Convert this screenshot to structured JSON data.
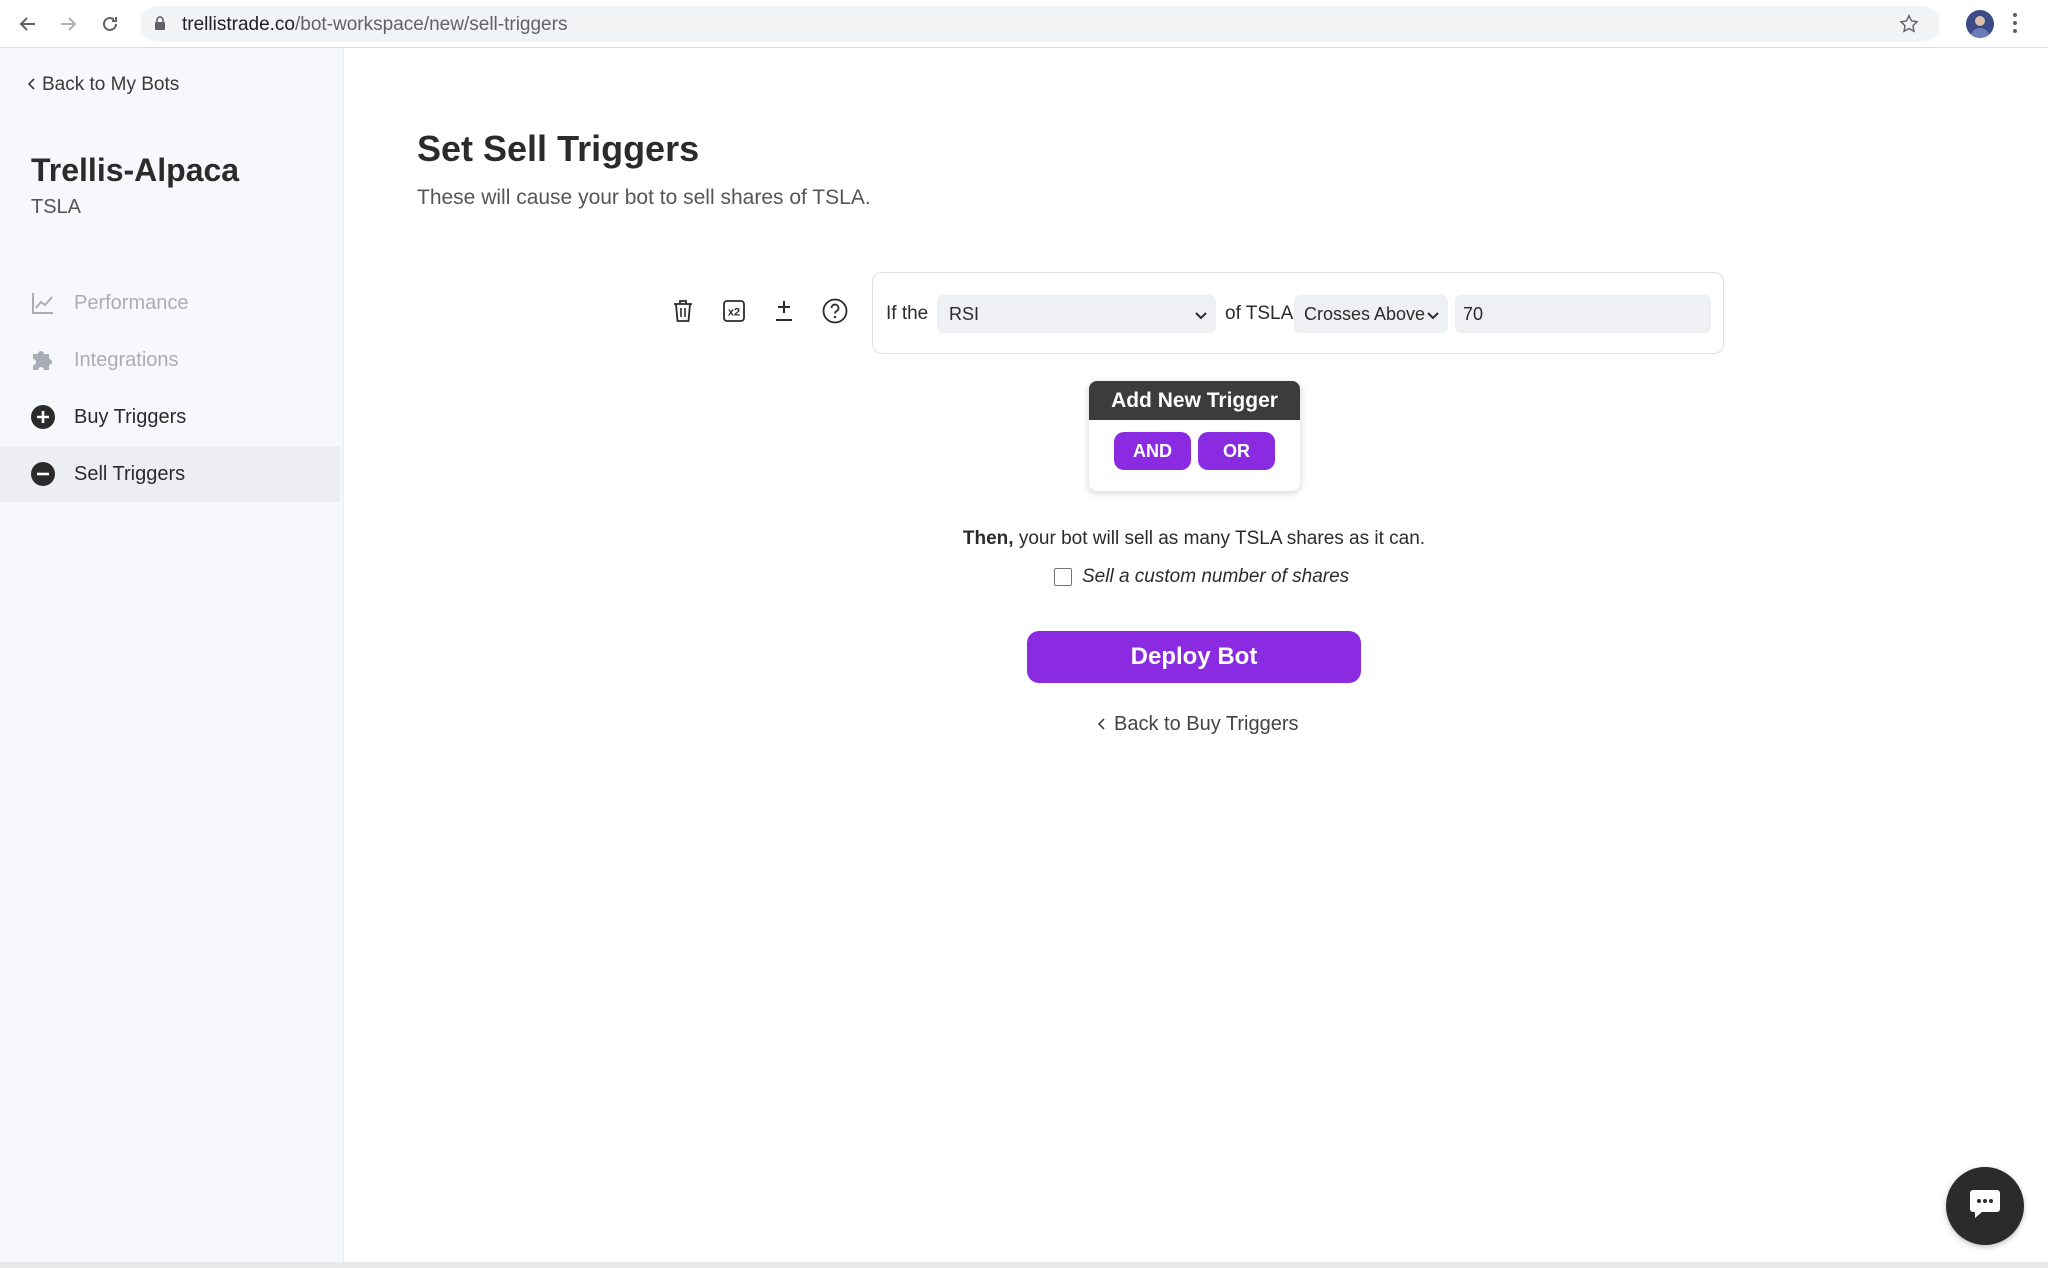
{
  "browser": {
    "url_host": "trellistrade.co",
    "url_path": "/bot-workspace/new/sell-triggers"
  },
  "sidebar": {
    "back_label": "Back to My Bots",
    "bot_name": "Trellis-Alpaca",
    "bot_ticker": "TSLA",
    "items": [
      {
        "label": "Performance",
        "icon": "chart-line-icon",
        "state": "disabled"
      },
      {
        "label": "Integrations",
        "icon": "puzzle-icon",
        "state": "disabled"
      },
      {
        "label": "Buy Triggers",
        "icon": "plus-circle-icon",
        "state": "normal"
      },
      {
        "label": "Sell Triggers",
        "icon": "minus-circle-icon",
        "state": "active"
      }
    ]
  },
  "main": {
    "title": "Set Sell Triggers",
    "subtitle": "These will cause your bot to sell shares of TSLA.",
    "trigger": {
      "prefix": "If the",
      "indicator": "RSI",
      "middle": "of TSLA",
      "condition": "Crosses Above",
      "value": "70"
    },
    "add_trigger": {
      "title": "Add New Trigger",
      "and_label": "AND",
      "or_label": "OR"
    },
    "then_bold": "Then,",
    "then_text": " your bot will sell as many TSLA shares as it can.",
    "custom_shares_label": "Sell a custom number of shares",
    "deploy_label": "Deploy Bot",
    "back_buy_label": "Back to Buy Triggers"
  },
  "colors": {
    "accent": "#8a2be2",
    "dark": "#2b2b2b",
    "sidebar_bg": "#f7f8fb"
  }
}
